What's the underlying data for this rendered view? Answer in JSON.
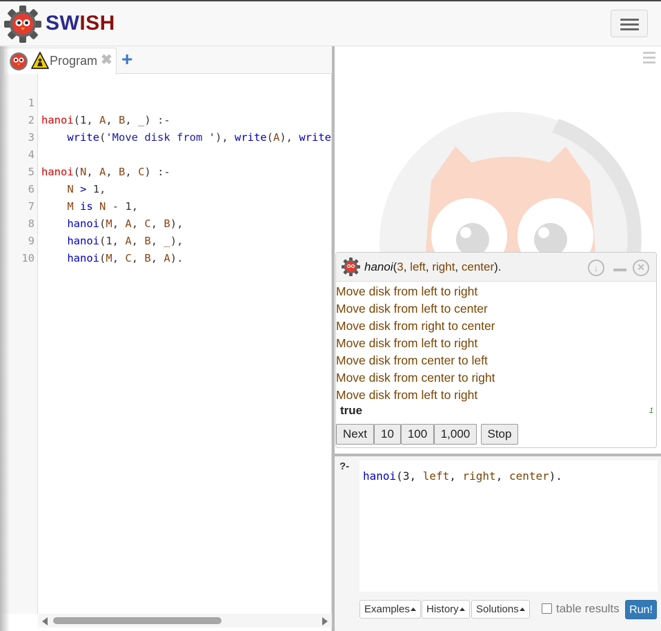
{
  "app": {
    "brand_part1": "SW",
    "brand_part2": "I",
    "brand_part3": "SH"
  },
  "editor": {
    "tab_label": "Program",
    "tab_close": "✖",
    "tab_add": "+",
    "line_numbers": [
      "1",
      "2",
      "3",
      "4",
      "5",
      "6",
      "7",
      "8",
      "9",
      "10"
    ]
  },
  "answer": {
    "query_head": "hanoi",
    "query_args": [
      "3",
      "left",
      "right",
      "center"
    ],
    "output_lines": [
      "Move disk from left to right",
      "Move disk from left to center",
      "Move disk from right to center",
      "Move disk from left to right",
      "Move disk from center to left",
      "Move disk from center to right",
      "Move disk from left to right"
    ],
    "result": "true",
    "solution_count": "1",
    "buttons": {
      "next": "Next",
      "ten": "10",
      "hundred": "100",
      "thousand": "1,000",
      "stop": "Stop"
    }
  },
  "query": {
    "prompt": "?-",
    "text_kw": "hanoi",
    "arg1": "3",
    "arg2": "left",
    "arg3": "right",
    "arg4": "center"
  },
  "toolbar": {
    "examples": "Examples",
    "history": "History",
    "solutions": "Solutions",
    "table_results": "table results",
    "run": "Run!"
  },
  "colors": {
    "run_button": "#337ab7",
    "brand_dark": "#2a2a8c",
    "brand_red": "#8a1010",
    "output_text": "#7a4400"
  }
}
